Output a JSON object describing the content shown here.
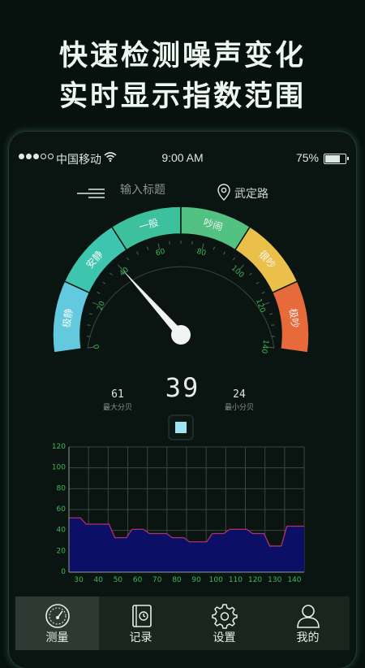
{
  "promo": {
    "line1": "快速检测噪声变化",
    "line2": "实时显示指数范围"
  },
  "status_bar": {
    "carrier": "中国移动",
    "time": "9:00 AM",
    "battery": "75%",
    "battery_level": 0.75
  },
  "header": {
    "title_placeholder": "输入标题",
    "location": "武定路"
  },
  "gauge": {
    "min": 0,
    "max": 140,
    "ticks": [
      "0",
      "20",
      "40",
      "60",
      "80",
      "100",
      "120",
      "140"
    ],
    "zones": [
      {
        "label": "极静",
        "color": "#62c9df"
      },
      {
        "label": "安静",
        "color": "#3ec5b0"
      },
      {
        "label": "一般",
        "color": "#3cc19c"
      },
      {
        "label": "吵闹",
        "color": "#52c181"
      },
      {
        "label": "很吵",
        "color": "#eac04a"
      },
      {
        "label": "极吵",
        "color": "#e66a3a"
      }
    ],
    "needle_value": 40
  },
  "readout": {
    "current": "39",
    "max_value": "61",
    "max_label": "最大分贝",
    "min_value": "24",
    "min_label": "最小分贝"
  },
  "chart_data": {
    "type": "area",
    "ylim": [
      0,
      120
    ],
    "yticks": [
      "0",
      "20",
      "40",
      "60",
      "80",
      "100",
      "120"
    ],
    "xticks": [
      "30",
      "40",
      "50",
      "60",
      "70",
      "80",
      "90",
      "100",
      "110",
      "120",
      "130",
      "140"
    ],
    "series": [
      {
        "values": [
          52,
          52,
          52,
          46,
          46,
          46,
          46,
          46,
          33,
          33,
          33,
          41,
          41,
          41,
          37,
          37,
          37,
          37,
          33,
          33,
          33,
          29,
          29,
          29,
          29,
          37,
          37,
          37,
          41,
          41,
          41,
          41,
          37,
          37,
          37,
          25,
          25,
          25,
          44,
          44,
          44,
          44
        ]
      }
    ]
  },
  "tabs": [
    {
      "label": "测量",
      "icon": "speedometer-icon",
      "active": true
    },
    {
      "label": "记录",
      "icon": "notebook-icon",
      "active": false
    },
    {
      "label": "设置",
      "icon": "gear-icon",
      "active": false
    },
    {
      "label": "我的",
      "icon": "user-icon",
      "active": false
    }
  ]
}
